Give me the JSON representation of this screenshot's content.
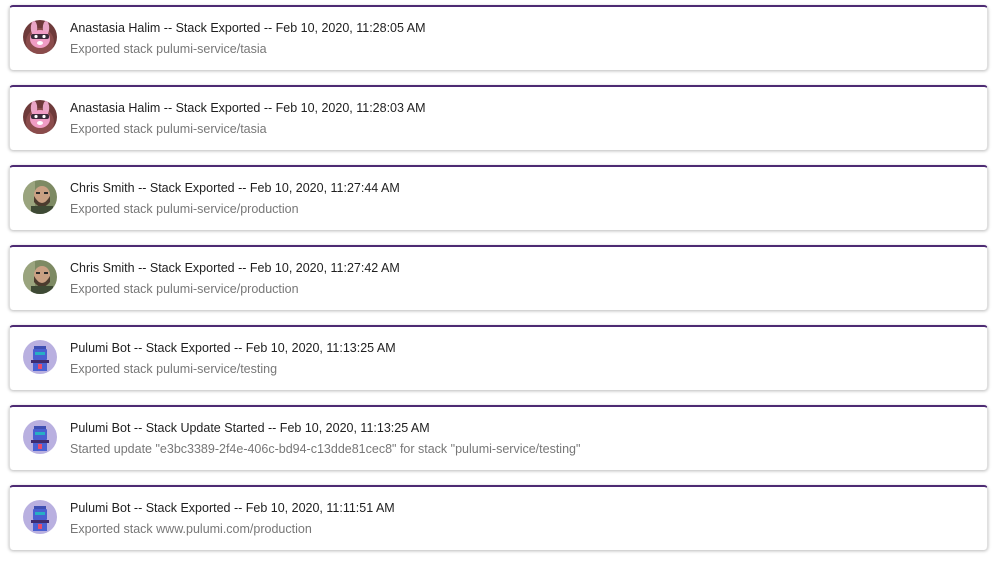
{
  "events": [
    {
      "avatar_icon": "bunny-avatar-icon",
      "title": "Anastasia Halim -- Stack Exported -- Feb 10, 2020, 11:28:05 AM",
      "description": "Exported stack pulumi-service/tasia"
    },
    {
      "avatar_icon": "bunny-avatar-icon",
      "title": "Anastasia Halim -- Stack Exported -- Feb 10, 2020, 11:28:03 AM",
      "description": "Exported stack pulumi-service/tasia"
    },
    {
      "avatar_icon": "user-photo-avatar-icon",
      "title": "Chris Smith -- Stack Exported -- Feb 10, 2020, 11:27:44 AM",
      "description": "Exported stack pulumi-service/production"
    },
    {
      "avatar_icon": "user-photo-avatar-icon",
      "title": "Chris Smith -- Stack Exported -- Feb 10, 2020, 11:27:42 AM",
      "description": "Exported stack pulumi-service/production"
    },
    {
      "avatar_icon": "robot-avatar-icon",
      "title": "Pulumi Bot -- Stack Exported -- Feb 10, 2020, 11:13:25 AM",
      "description": "Exported stack pulumi-service/testing"
    },
    {
      "avatar_icon": "robot-avatar-icon",
      "title": "Pulumi Bot -- Stack Update Started -- Feb 10, 2020, 11:13:25 AM",
      "description": "Started update \"e3bc3389-2f4e-406c-bd94-c13dde81cec8\" for stack \"pulumi-service/testing\""
    },
    {
      "avatar_icon": "robot-avatar-icon",
      "title": "Pulumi Bot -- Stack Exported -- Feb 10, 2020, 11:11:51 AM",
      "description": "Exported stack www.pulumi.com/production"
    }
  ],
  "colors": {
    "card_accent": "#4d2a73",
    "title_text": "#1f1f1f",
    "description_text": "#777777"
  }
}
